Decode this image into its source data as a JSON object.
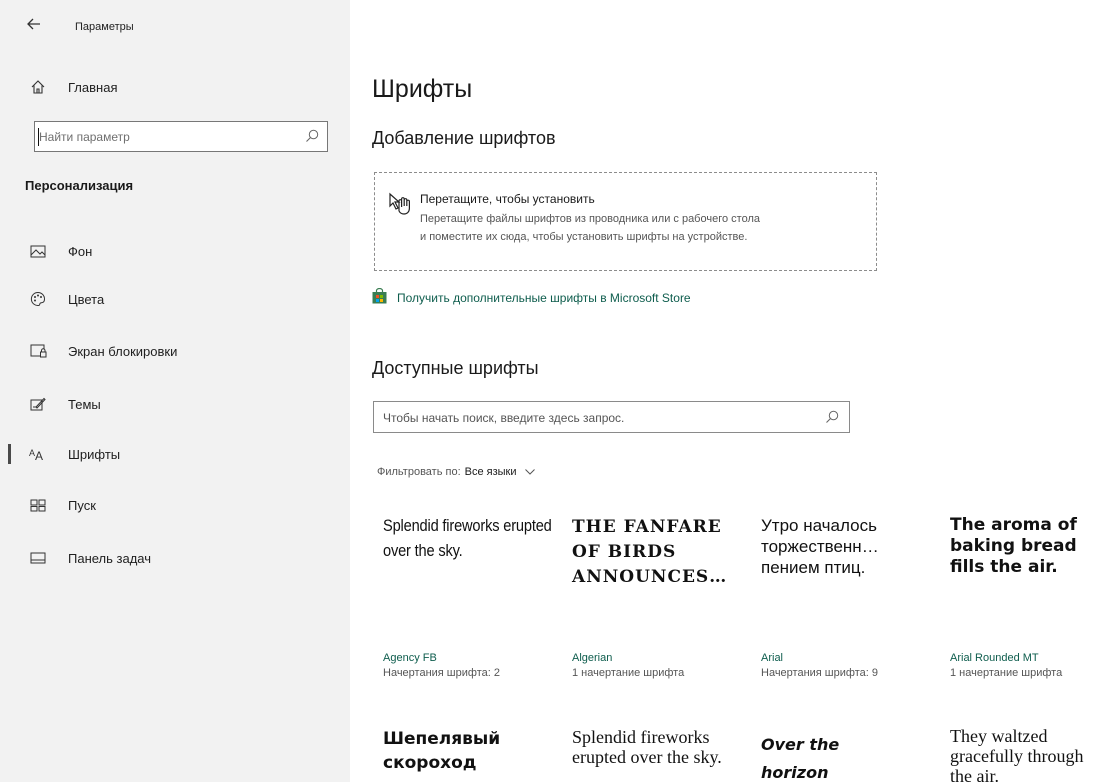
{
  "titlebar": {
    "back_icon": "back-arrow-icon",
    "title": "Параметры"
  },
  "sidebar": {
    "home_label": "Главная",
    "search_placeholder": "Найти параметр",
    "section_title": "Персонализация",
    "items": [
      {
        "icon": "image-icon",
        "label": "Фон"
      },
      {
        "icon": "palette-icon",
        "label": "Цвета"
      },
      {
        "icon": "lock-screen-icon",
        "label": "Экран блокировки"
      },
      {
        "icon": "themes-icon",
        "label": "Темы"
      },
      {
        "icon": "fonts-icon",
        "label": "Шрифты",
        "active": true
      },
      {
        "icon": "start-icon",
        "label": "Пуск"
      },
      {
        "icon": "taskbar-icon",
        "label": "Панель задач"
      }
    ]
  },
  "main": {
    "title": "Шрифты",
    "add_fonts_heading": "Добавление шрифтов",
    "dropzone": {
      "title": "Перетащите, чтобы установить",
      "desc_line1": "Перетащите файлы шрифтов из проводника или с рабочего стола",
      "desc_line2": "и поместите их сюда, чтобы установить шрифты на устройстве."
    },
    "store_link": "Получить дополнительные шрифты в Microsoft Store",
    "available_heading": "Доступные шрифты",
    "search_placeholder": "Чтобы начать поиск, введите здесь запрос.",
    "filter_label": "Фильтровать по:",
    "filter_value": "Все языки",
    "fonts_row1": [
      {
        "sample": "Splendid fireworks erupted over the sky.",
        "name": "Agency FB",
        "styles": "Начертания шрифта: 2"
      },
      {
        "sample": "THE FANFARE OF BIRDS ANNOUNCES…",
        "name": "Algerian",
        "styles": "1 начертание шрифта"
      },
      {
        "sample": "Утро началось торжественн… пением птиц.",
        "name": "Arial",
        "styles": "Начертания шрифта: 9"
      },
      {
        "sample": "The aroma of baking bread fills the air.",
        "name": "Arial Rounded MT",
        "styles": "1 начертание шрифта"
      }
    ],
    "fonts_row2": [
      {
        "sample": "Шепелявый скороход"
      },
      {
        "sample": "Splendid fireworks erupted over the sky."
      },
      {
        "sample": "Over the horizon comes"
      },
      {
        "sample": "They waltzed gracefully through the air."
      }
    ]
  },
  "colors": {
    "accent": "#0e5d4d",
    "sidebar_bg": "#f2f2f2"
  }
}
